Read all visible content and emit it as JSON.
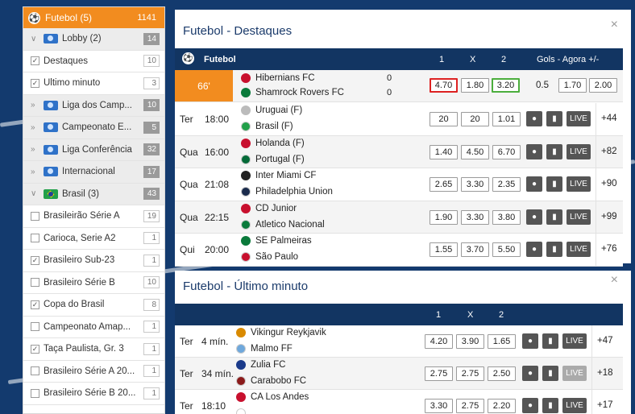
{
  "sidebar": {
    "header": {
      "label": "Futebol (5)",
      "count": "1141"
    },
    "items": [
      {
        "type": "group",
        "label": "Lobby (2)",
        "count": "14",
        "icon": "intl",
        "chev": "∨"
      },
      {
        "type": "check",
        "label": "Destaques",
        "count": "10",
        "checked": true
      },
      {
        "type": "check",
        "label": "Último minuto",
        "count": "3",
        "checked": true
      },
      {
        "type": "group",
        "label": "Liga dos Camp...",
        "count": "10",
        "icon": "intl",
        "chev": "»"
      },
      {
        "type": "group",
        "label": "Campeonato E...",
        "count": "5",
        "icon": "intl",
        "chev": "»"
      },
      {
        "type": "group",
        "label": "Liga Conferência",
        "count": "32",
        "icon": "intl",
        "chev": "»"
      },
      {
        "type": "group",
        "label": "Internacional",
        "count": "17",
        "icon": "intl",
        "chev": "»"
      },
      {
        "type": "group",
        "label": "Brasil (3)",
        "count": "43",
        "icon": "br",
        "chev": "∨"
      },
      {
        "type": "check",
        "label": "Brasileirão Série A",
        "count": "19",
        "checked": false
      },
      {
        "type": "check",
        "label": "Carioca, Serie A2",
        "count": "1",
        "checked": false
      },
      {
        "type": "check",
        "label": "Brasileiro Sub-23",
        "count": "1",
        "checked": true
      },
      {
        "type": "check",
        "label": "Brasileiro Série B",
        "count": "10",
        "checked": false
      },
      {
        "type": "check",
        "label": "Copa do Brasil",
        "count": "8",
        "checked": true
      },
      {
        "type": "check",
        "label": "Campeonato Amap...",
        "count": "1",
        "checked": false
      },
      {
        "type": "check",
        "label": "Taça Paulista, Gr. 3",
        "count": "1",
        "checked": true
      },
      {
        "type": "check",
        "label": "Brasileiro Série A 20...",
        "count": "1",
        "checked": false
      },
      {
        "type": "check",
        "label": "Brasileiro Série B 20...",
        "count": "1",
        "checked": false
      }
    ]
  },
  "destaques": {
    "title": "Futebol - Destaques",
    "bar": {
      "sport": "Futebol",
      "c1": "1",
      "cx": "X",
      "c2": "2",
      "gols": "Gols - Agora +/-"
    },
    "live": {
      "minute": "66'",
      "home": "Hibernians FC",
      "away": "Shamrock Rovers FC",
      "home_score": "0",
      "away_score": "0",
      "o1": "4.70",
      "ox": "1.80",
      "o2": "3.20",
      "line": "0.5",
      "over": "1.70",
      "under": "2.00"
    },
    "matches": [
      {
        "day": "Ter",
        "time": "18:00",
        "home": "Uruguai (F)",
        "away": "Brasil (F)",
        "o1": "20",
        "ox": "20",
        "o2": "1.01",
        "more": "+44",
        "hc": "#bbbbbb",
        "ac": "#22a04a"
      },
      {
        "day": "Qua",
        "time": "16:00",
        "home": "Holanda (F)",
        "away": "Portugal (F)",
        "o1": "1.40",
        "ox": "4.50",
        "o2": "6.70",
        "more": "+82",
        "hc": "#c8102e",
        "ac": "#046a38"
      },
      {
        "day": "Qua",
        "time": "21:08",
        "home": "Inter Miami CF",
        "away": "Philadelphia Union",
        "o1": "2.65",
        "ox": "3.30",
        "o2": "2.35",
        "more": "+90",
        "hc": "#222222",
        "ac": "#1a2b4c"
      },
      {
        "day": "Qua",
        "time": "22:15",
        "home": "CD Junior",
        "away": "Atletico Nacional",
        "o1": "1.90",
        "ox": "3.30",
        "o2": "3.80",
        "more": "+99",
        "hc": "#c8102e",
        "ac": "#0a7a3b"
      },
      {
        "day": "Qui",
        "time": "20:00",
        "home": "SE Palmeiras",
        "away": "São Paulo",
        "o1": "1.55",
        "ox": "3.70",
        "o2": "5.50",
        "more": "+76",
        "hc": "#0a7a3b",
        "ac": "#c8102e"
      }
    ]
  },
  "ultimo": {
    "title": "Futebol - Último minuto",
    "bar": {
      "c1": "1",
      "cx": "X",
      "c2": "2"
    },
    "matches": [
      {
        "day": "Ter",
        "time": "4 mín.",
        "home": "Vikingur Reykjavik",
        "away": "Malmo FF",
        "o1": "4.20",
        "ox": "3.90",
        "o2": "1.65",
        "more": "+47",
        "hc": "#d98a00",
        "ac": "#6fa8dc",
        "live_dim": false
      },
      {
        "day": "Ter",
        "time": "34 mín.",
        "home": "Zulia FC",
        "away": "Carabobo FC",
        "o1": "2.75",
        "ox": "2.75",
        "o2": "2.50",
        "more": "+18",
        "hc": "#1a3a8a",
        "ac": "#8b1a1a",
        "live_dim": true
      },
      {
        "day": "Ter",
        "time": "18:10",
        "home": "CA Los Andes",
        "away": "",
        "o1": "3.30",
        "ox": "2.75",
        "o2": "2.20",
        "more": "+17",
        "hc": "#c8102e",
        "ac": "#ffffff",
        "live_dim": false
      }
    ]
  },
  "live_label": "LIVE",
  "close_glyph": "×"
}
